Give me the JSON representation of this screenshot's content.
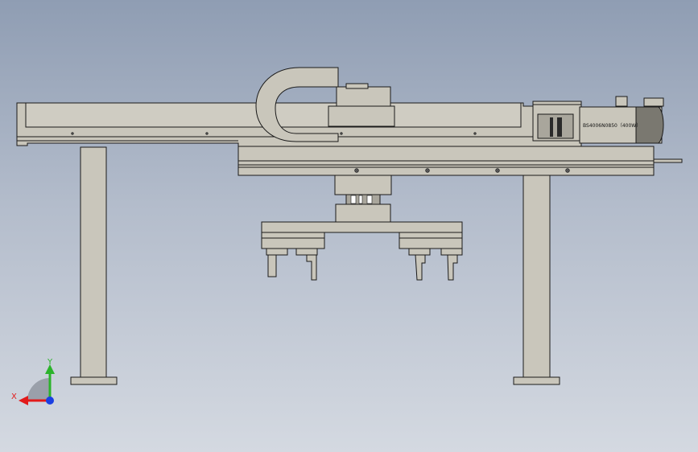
{
  "motor": {
    "label": "BS4006N0850（400W）"
  },
  "triad": {
    "x_label": "X",
    "y_label": "Y",
    "x_color": "#e21a1a",
    "y_color": "#2bb32b",
    "z_color": "#1a3fe2"
  },
  "colors": {
    "background_top": "#8f9db3",
    "background_bottom": "#d4d9e1",
    "part_fill": "#c9c6bb",
    "edge": "#1a1a1a"
  }
}
